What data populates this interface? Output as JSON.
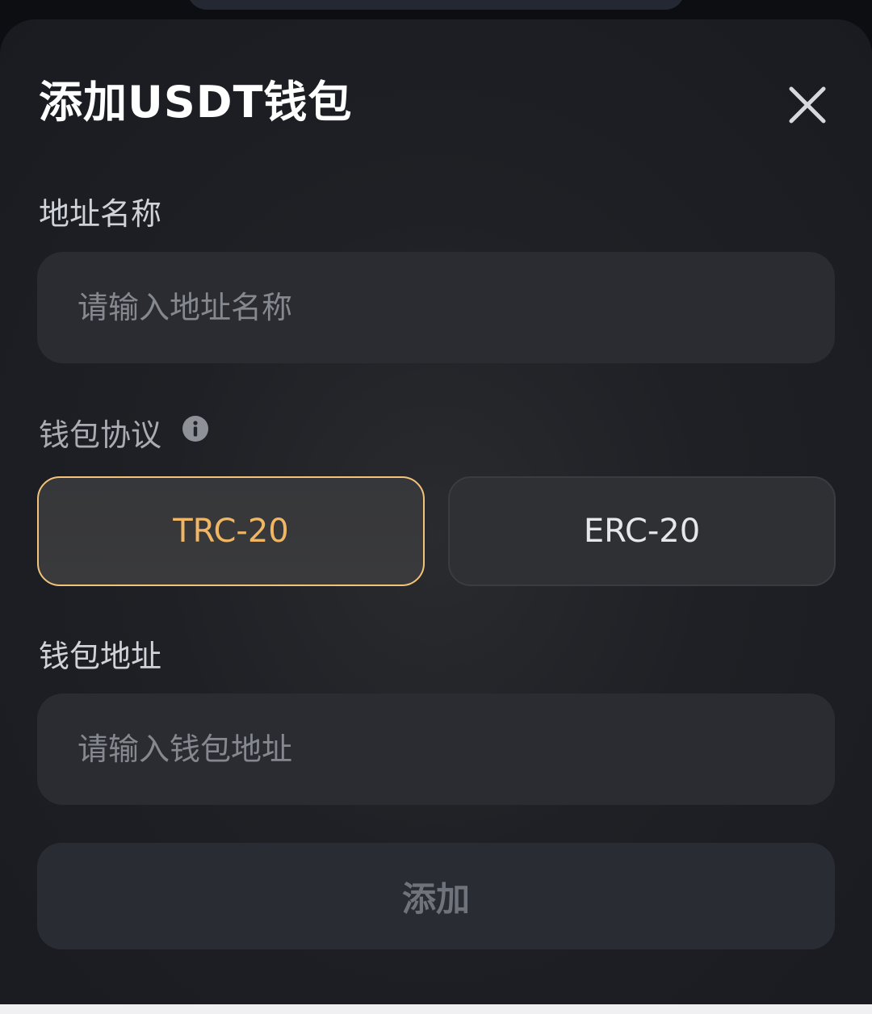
{
  "sheet": {
    "title": "添加USDT钱包"
  },
  "form": {
    "address_name": {
      "label": "地址名称",
      "placeholder": "请输入地址名称",
      "value": ""
    },
    "protocol": {
      "label": "钱包协议",
      "options": [
        {
          "label": "TRC-20",
          "selected": true
        },
        {
          "label": "ERC-20",
          "selected": false
        }
      ]
    },
    "wallet_address": {
      "label": "钱包地址",
      "placeholder": "请输入钱包地址",
      "value": ""
    },
    "submit_label": "添加"
  },
  "colors": {
    "accent": "#f0b664",
    "background": "#1e2025",
    "input_bg": "#2a2c32"
  },
  "icons": {
    "close": "close-icon",
    "info": "info-icon"
  }
}
